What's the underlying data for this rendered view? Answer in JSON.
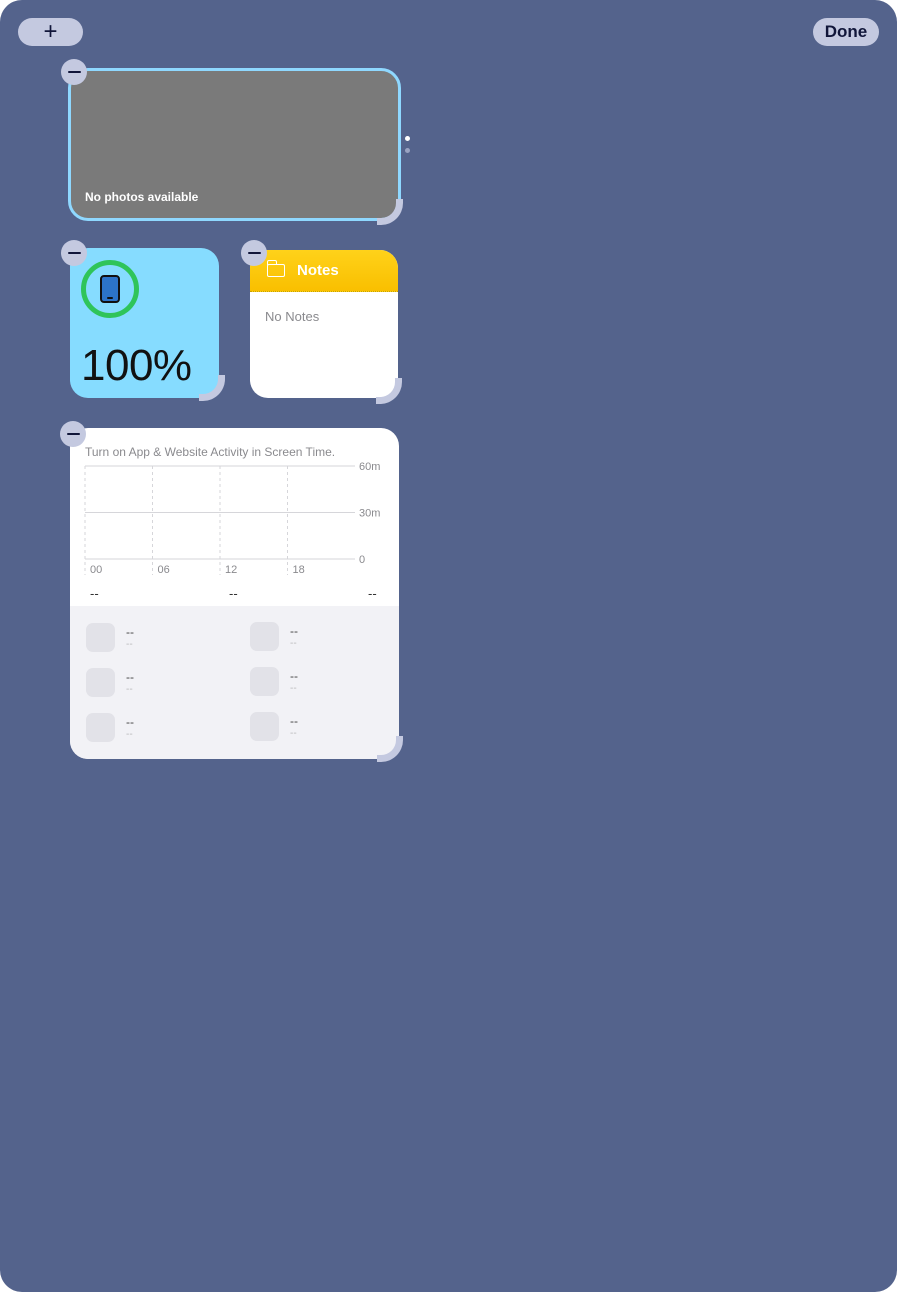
{
  "toolbar": {
    "add_label": "+",
    "done_label": "Done"
  },
  "photos_widget": {
    "caption": "No photos available",
    "pages": 2,
    "active_page": 1
  },
  "battery_widget": {
    "percent_label": "100%",
    "level": 1.0,
    "ring_color": "#2fc45a"
  },
  "notes_widget": {
    "title": "Notes",
    "empty_text": "No Notes"
  },
  "screen_time_widget": {
    "message": "Turn on App & Website Activity in Screen Time.",
    "averages": [
      "--",
      "--",
      "--"
    ],
    "apps": [
      {
        "name": "--",
        "time": "--"
      },
      {
        "name": "--",
        "time": "--"
      },
      {
        "name": "--",
        "time": "--"
      },
      {
        "name": "--",
        "time": "--"
      },
      {
        "name": "--",
        "time": "--"
      },
      {
        "name": "--",
        "time": "--"
      }
    ]
  },
  "chart_data": {
    "type": "bar",
    "categories": [
      "00",
      "06",
      "12",
      "18"
    ],
    "values": [],
    "yticks": [
      "60m",
      "30m",
      "0"
    ],
    "ylim": [
      0,
      60
    ],
    "grid": true
  },
  "colors": {
    "background": "#54638c",
    "control": "#c4c9e0",
    "photo_border": "#8fd8ff",
    "battery_bg": "#86dcff",
    "notes_header": "#ffd21a"
  }
}
